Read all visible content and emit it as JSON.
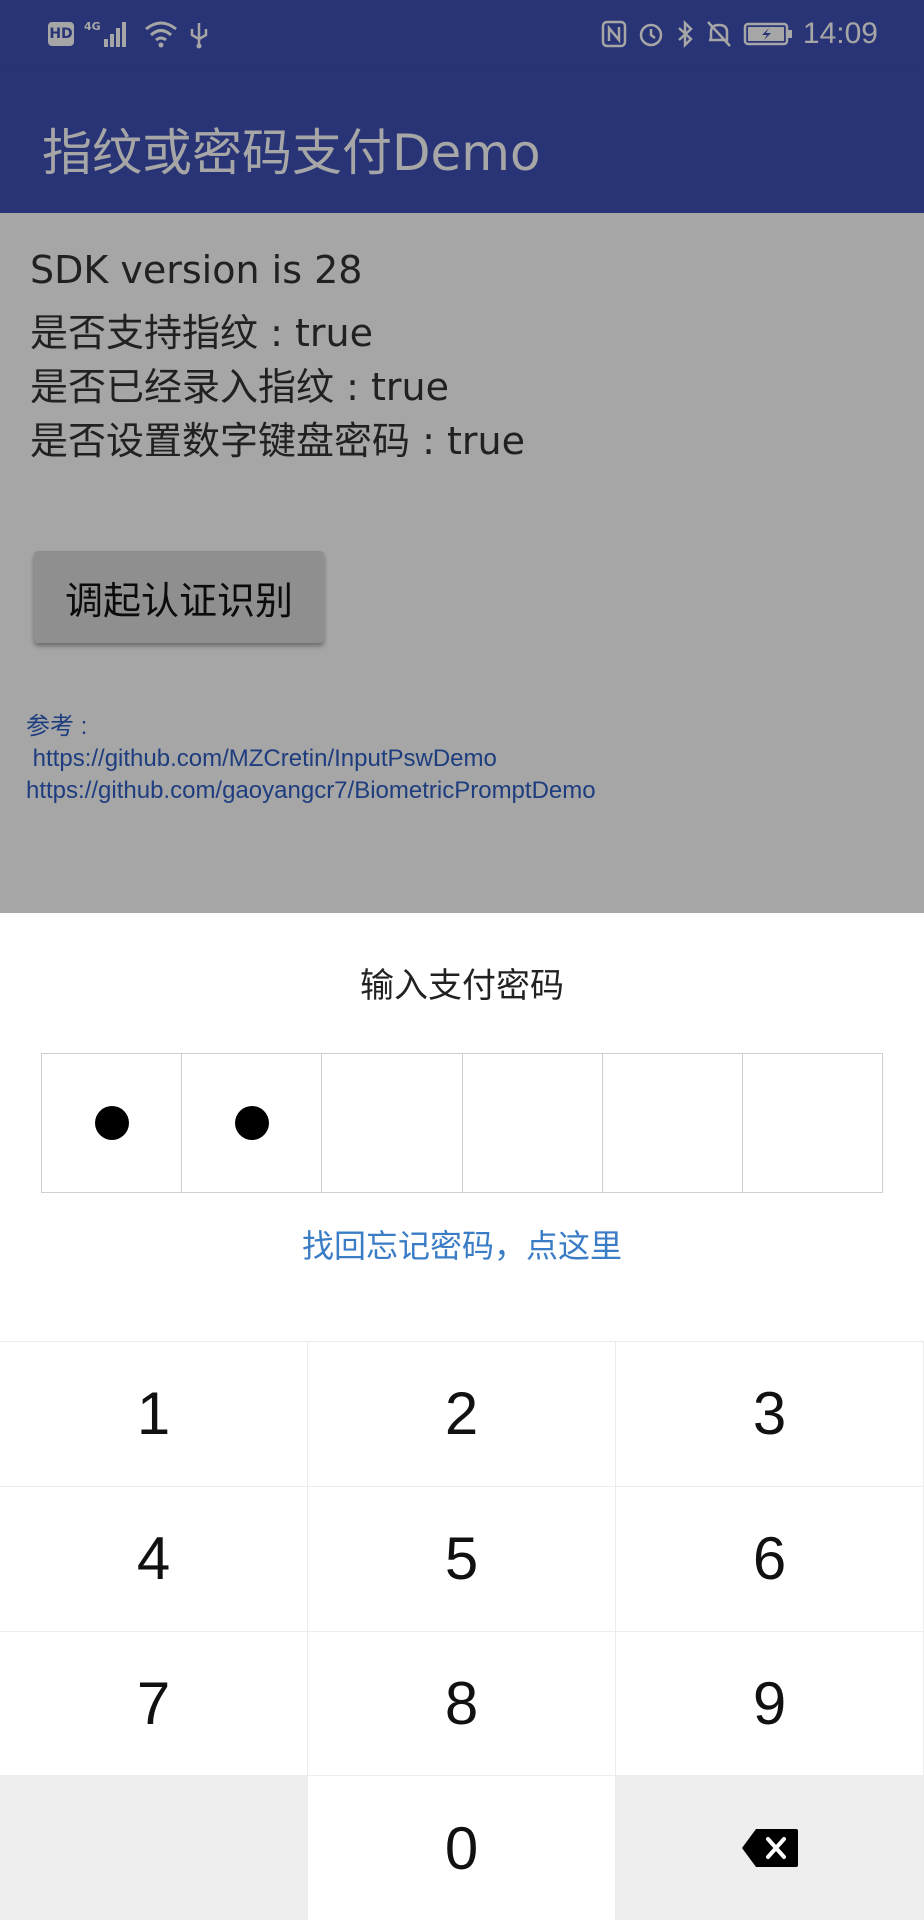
{
  "status_bar": {
    "hd_badge": "HD",
    "network": "4G",
    "time": "14:09",
    "icons": [
      "hd-icon",
      "signal-icon",
      "wifi-icon",
      "usb-icon",
      "nfc-icon",
      "alarm-icon",
      "bluetooth-icon",
      "mute-icon",
      "battery-icon"
    ]
  },
  "app_bar": {
    "title": "指纹或密码支付Demo",
    "color": "#3f51b5"
  },
  "info": {
    "sdk_version": "SDK version is 28",
    "supports_fingerprint": "是否支持指纹 : true",
    "fingerprint_enrolled": "是否已经录入指纹 : true",
    "keypad_password_set": "是否设置数字键盘密码 : true"
  },
  "auth_button": {
    "label": "调起认证识别"
  },
  "references": {
    "label": "参考 :",
    "link1": " https://github.com/MZCretin/InputPswDemo",
    "link2": "https://github.com/gaoyangcr7/BiometricPromptDemo"
  },
  "sheet": {
    "title": "输入支付密码",
    "password_length": 6,
    "filled_count": 2,
    "forgot_link": "找回忘记密码，点这里",
    "link_color": "#3a7cc6"
  },
  "keypad": {
    "keys": [
      "1",
      "2",
      "3",
      "4",
      "5",
      "6",
      "7",
      "8",
      "9",
      "",
      "0",
      "delete"
    ]
  }
}
